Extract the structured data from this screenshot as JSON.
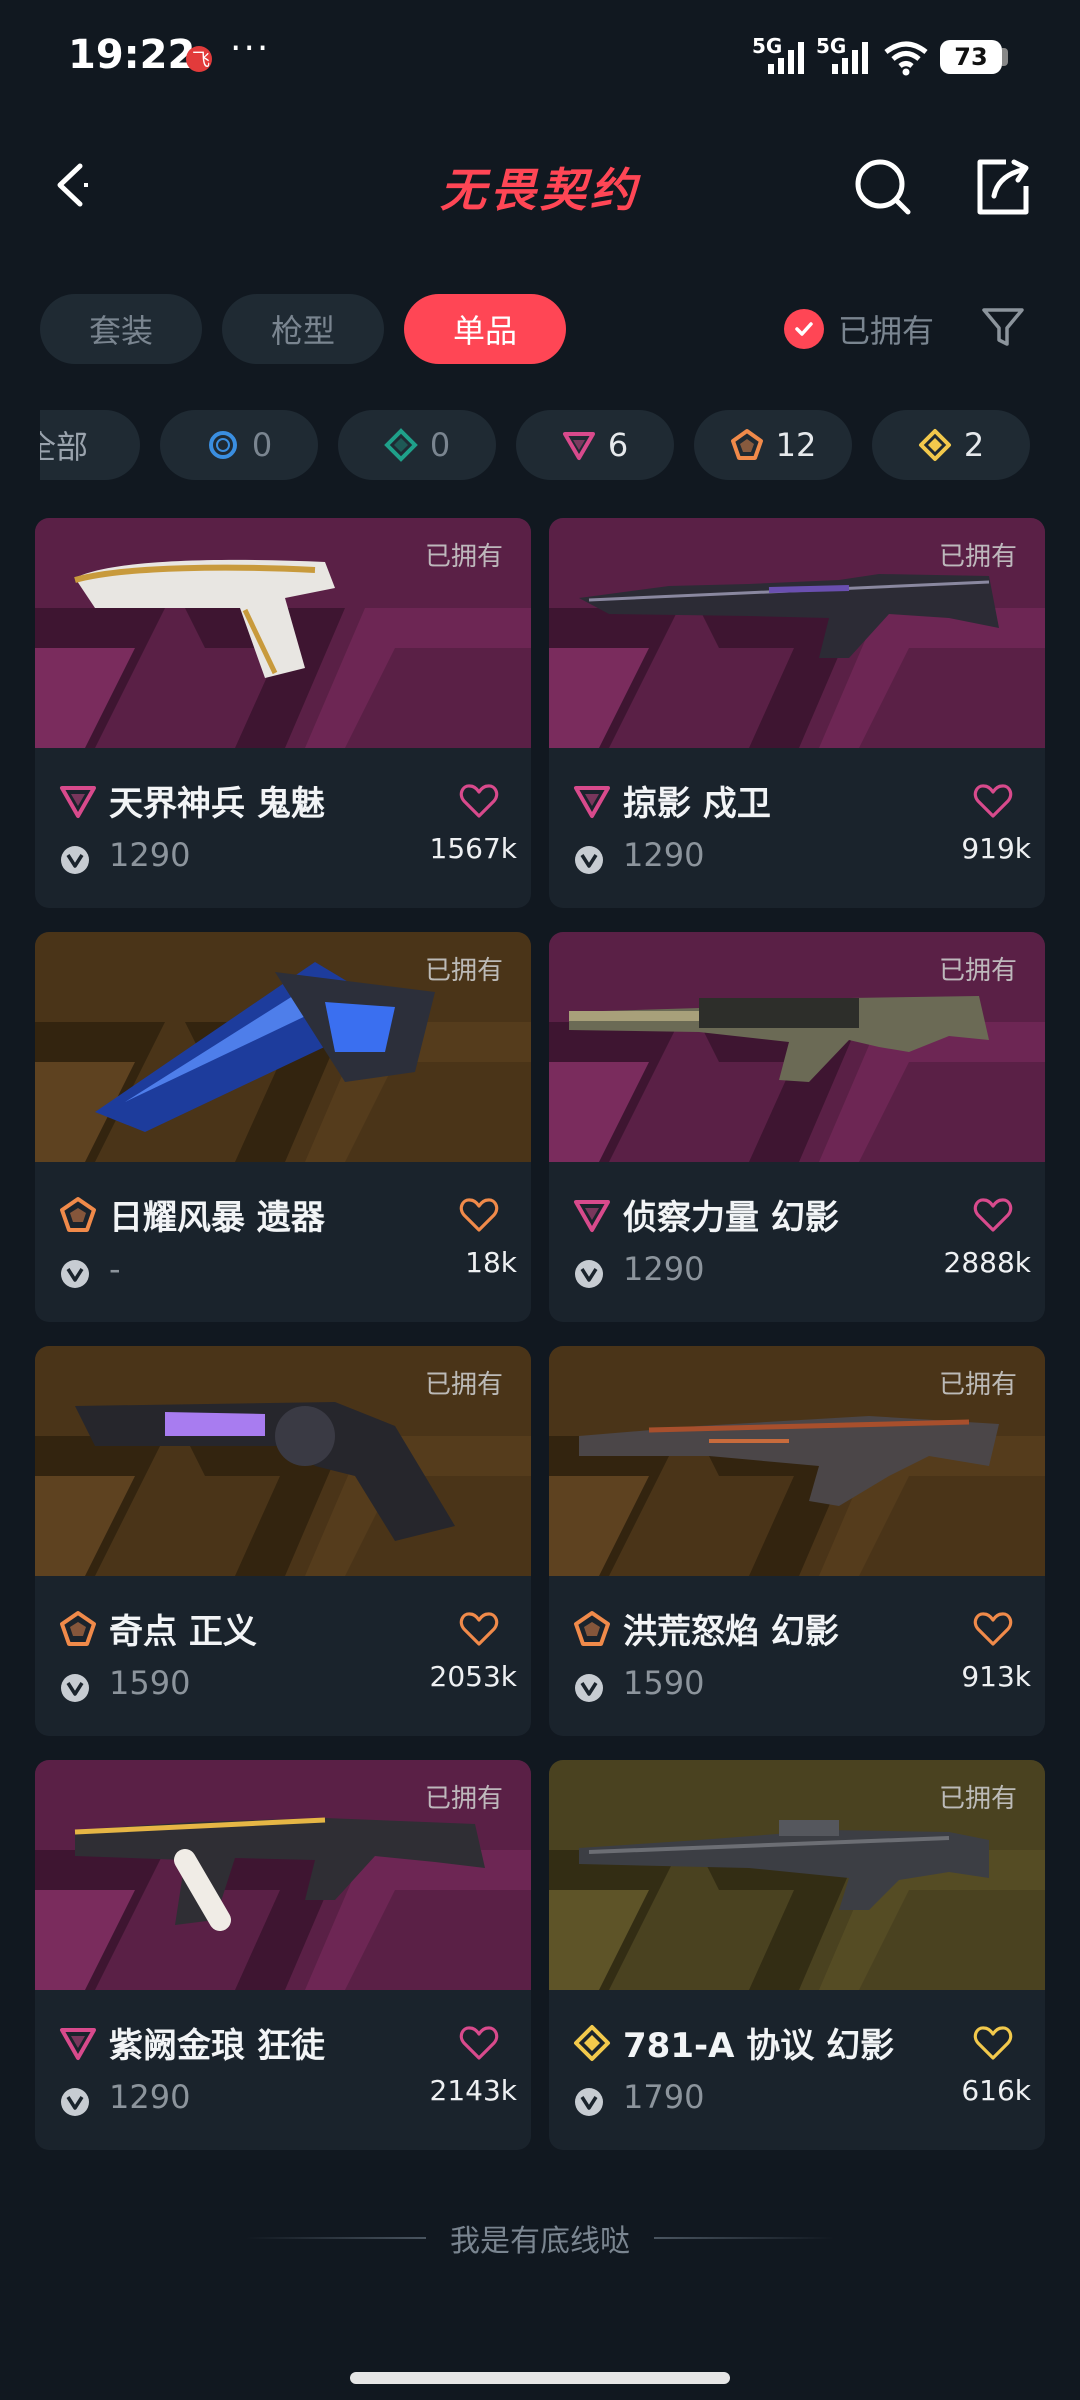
{
  "status_bar": {
    "time": "19:22",
    "network_1": "5G",
    "network_2": "5G",
    "battery": "73"
  },
  "header": {
    "title": "无畏契约"
  },
  "tabs": [
    {
      "label": "套装",
      "active": false
    },
    {
      "label": "枪型",
      "active": false
    },
    {
      "label": "单品",
      "active": true
    }
  ],
  "owned_filter": {
    "label": "已拥有",
    "checked": true
  },
  "tier_chips": [
    {
      "label": "全部"
    },
    {
      "tier": "select",
      "count": "0",
      "color": "#3a8ee0"
    },
    {
      "tier": "deluxe",
      "count": "0",
      "color": "#1fa08a"
    },
    {
      "tier": "premium",
      "count": "6",
      "color": "#d84a8c"
    },
    {
      "tier": "ultra",
      "count": "12",
      "color": "#f08a4a"
    },
    {
      "tier": "exclusive",
      "count": "2",
      "color": "#f2c94c"
    }
  ],
  "items": [
    {
      "name": "天界神兵 鬼魅",
      "price": "1290",
      "likes": "1567k",
      "owned_label": "已拥有",
      "tier": "premium",
      "tier_color": "#d84a8c",
      "bg": "purple",
      "gun": "pistol-white"
    },
    {
      "name": "掠影 戍卫",
      "price": "1290",
      "likes": "919k",
      "owned_label": "已拥有",
      "tier": "premium",
      "tier_color": "#d84a8c",
      "bg": "purple",
      "gun": "rifle-dark"
    },
    {
      "name": "日耀风暴 遗器",
      "price": "-",
      "likes": "18k",
      "owned_label": "已拥有",
      "tier": "ultra",
      "tier_color": "#f08a4a",
      "bg": "gold",
      "gun": "knife-blue"
    },
    {
      "name": "侦察力量 幻影",
      "price": "1290",
      "likes": "2888k",
      "owned_label": "已拥有",
      "tier": "premium",
      "tier_color": "#d84a8c",
      "bg": "purple",
      "gun": "rifle-tan"
    },
    {
      "name": "奇点 正义",
      "price": "1590",
      "likes": "2053k",
      "owned_label": "已拥有",
      "tier": "ultra",
      "tier_color": "#f08a4a",
      "bg": "gold",
      "gun": "revolver"
    },
    {
      "name": "洪荒怒焰 幻影",
      "price": "1590",
      "likes": "913k",
      "owned_label": "已拥有",
      "tier": "ultra",
      "tier_color": "#f08a4a",
      "bg": "gold",
      "gun": "rifle-dragon"
    },
    {
      "name": "紫阙金琅 狂徒",
      "price": "1290",
      "likes": "2143k",
      "owned_label": "已拥有",
      "tier": "premium",
      "tier_color": "#d84a8c",
      "bg": "purple",
      "gun": "ak-gold"
    },
    {
      "name": "781-A 协议 幻影",
      "price": "1790",
      "likes": "616k",
      "owned_label": "已拥有",
      "tier": "exclusive",
      "tier_color": "#f2c94c",
      "bg": "olive",
      "gun": "rifle-gray"
    }
  ],
  "footer": {
    "text": "我是有底线哒"
  }
}
